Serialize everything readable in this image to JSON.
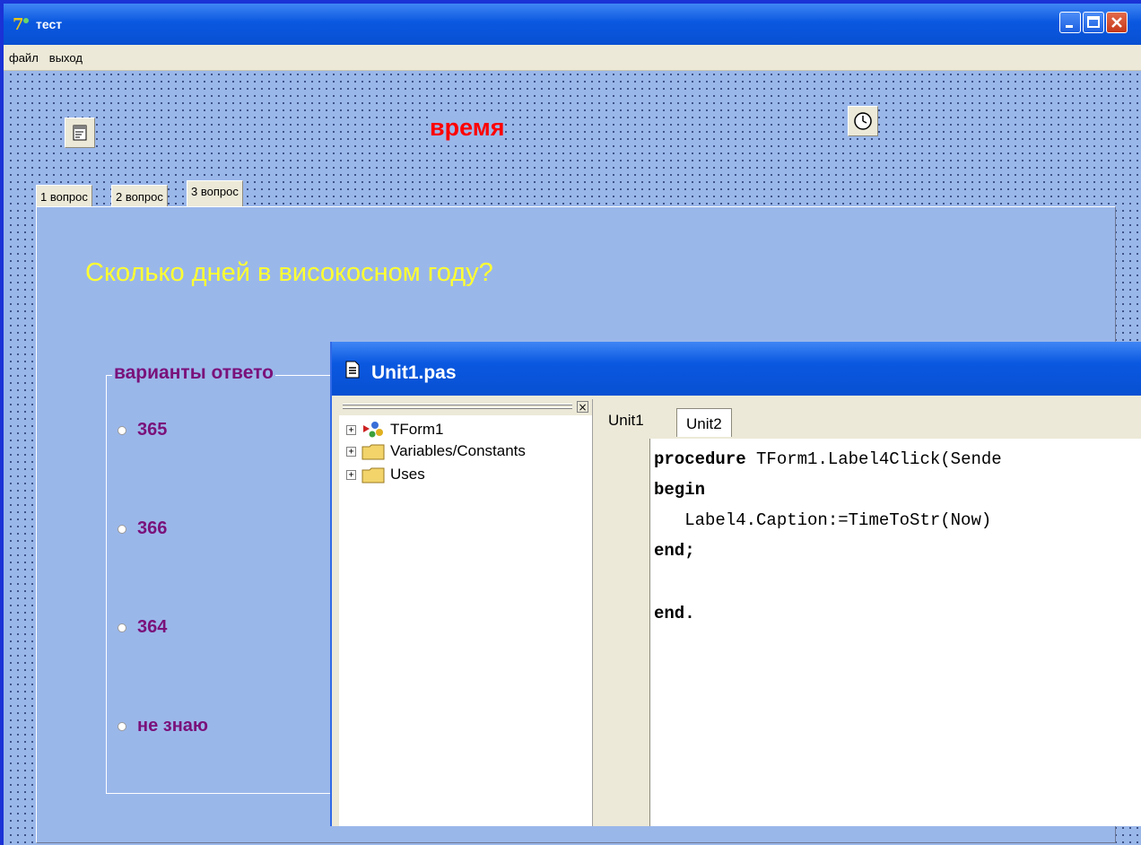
{
  "main_window": {
    "title": "тест",
    "menu": [
      "файл",
      "выход"
    ]
  },
  "form": {
    "time_label": "время",
    "tabs": [
      "1 вопрос",
      "2 вопрос",
      "3 вопрос"
    ],
    "active_tab": 2,
    "question": "Сколько дней в високосном году?",
    "group_title": "варианты ответо",
    "options": [
      "365",
      "366",
      "364",
      "не знаю"
    ]
  },
  "code_window": {
    "title": "Unit1.pas",
    "explorer": {
      "items": [
        "TForm1",
        "Variables/Constants",
        "Uses"
      ]
    },
    "tabs": [
      "Unit1",
      "Unit2"
    ],
    "code": {
      "line1_kw": "procedure",
      "line1_rest": " TForm1.Label4Click(Sende",
      "line2_kw": "begin",
      "line3": "   Label4.Caption:=TimeToStr(Now)",
      "line4_kw": "end;",
      "line6_kw": "end."
    }
  },
  "colors": {
    "form_bg": "#9ab7ea",
    "question_text": "#ffff33",
    "options_text": "#7a117a",
    "time_label": "#ff0000",
    "titlebar": "#0a58e0"
  }
}
